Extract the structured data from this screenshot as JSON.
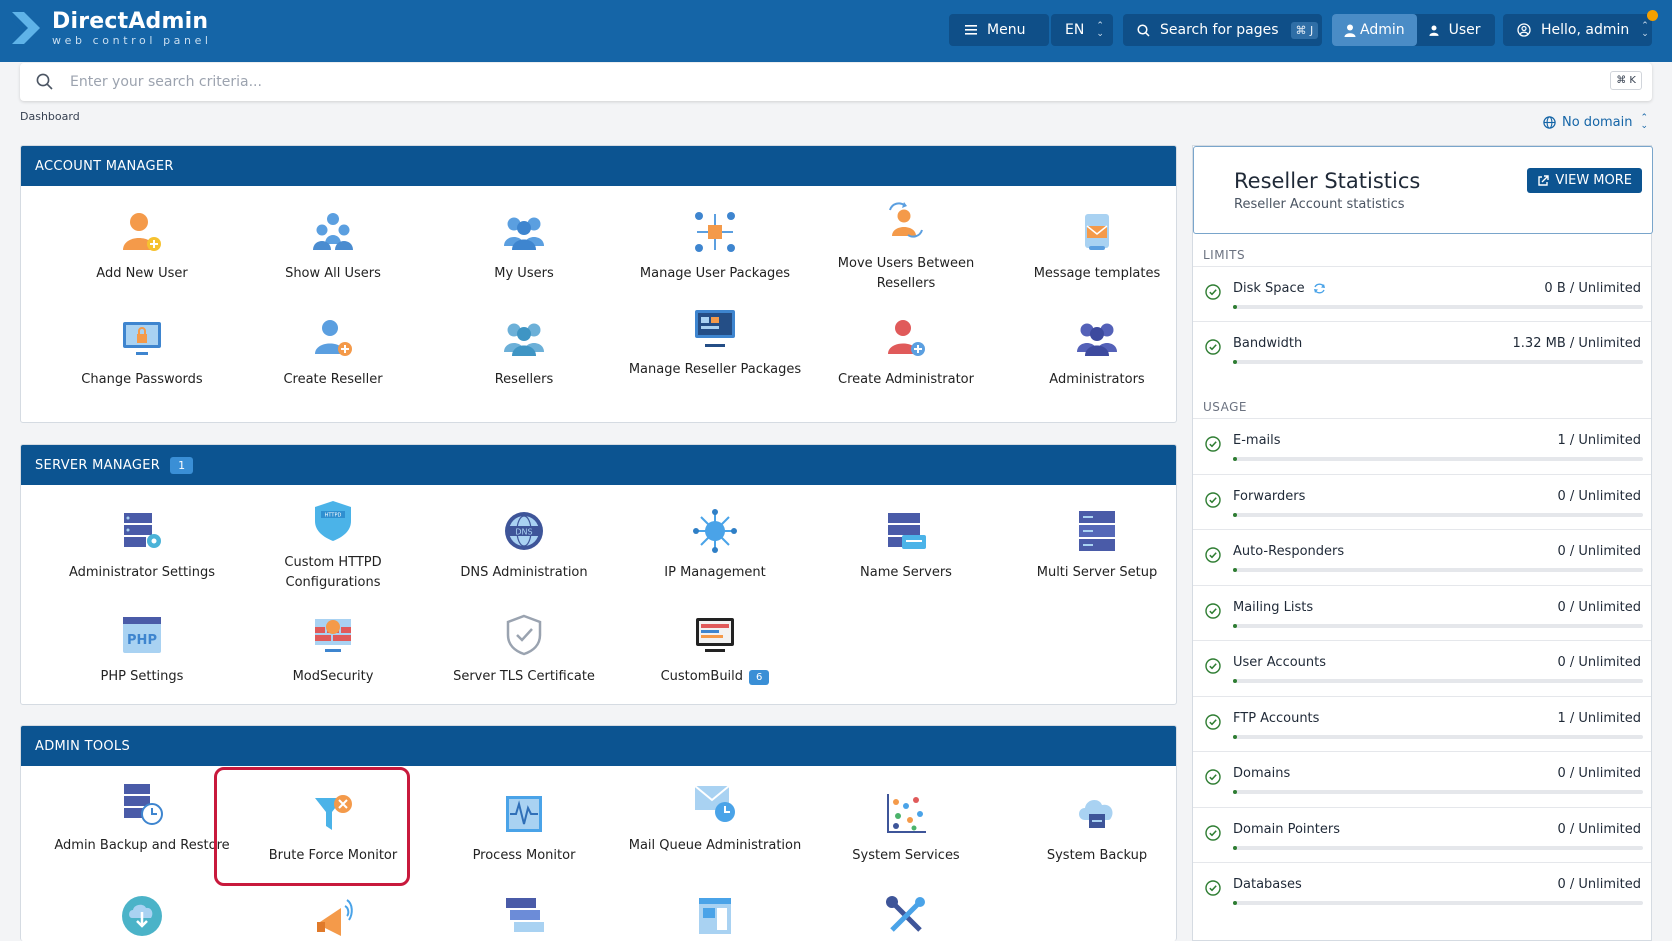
{
  "brand": {
    "title": "DirectAdmin",
    "subtitle": "web control panel"
  },
  "header": {
    "menu_label": "Menu",
    "language": "EN",
    "search_pages_label": "Search for pages",
    "search_pages_shortcut": "⌘ J",
    "role_admin": "Admin",
    "role_user": "User",
    "greeting": "Hello, admin"
  },
  "search": {
    "placeholder": "Enter your search criteria...",
    "shortcut": "⌘ K"
  },
  "breadcrumb": "Dashboard",
  "domain_selector": "No domain",
  "account_manager": {
    "title": "ACCOUNT MANAGER",
    "items": [
      "Add New User",
      "Show All Users",
      "My Users",
      "Manage User Packages",
      "Move Users Between Resellers",
      "Message templates",
      "Change Passwords",
      "Create Reseller",
      "Resellers",
      "Manage Reseller Packages",
      "Create Administrator",
      "Administrators"
    ]
  },
  "server_manager": {
    "title": "SERVER MANAGER",
    "badge": "1",
    "items": [
      "Administrator Settings",
      "Custom HTTPD Configurations",
      "DNS Administration",
      "IP Management",
      "Name Servers",
      "Multi Server Setup",
      "PHP Settings",
      "ModSecurity",
      "Server TLS Certificate",
      "CustomBuild"
    ],
    "custombuild_badge": "6"
  },
  "admin_tools": {
    "title": "ADMIN TOOLS",
    "items": [
      "Admin Backup and Restore",
      "Brute Force Monitor",
      "Process Monitor",
      "Mail Queue Administration",
      "System Services",
      "System Backup"
    ]
  },
  "reseller_stats": {
    "title": "Reseller Statistics",
    "subtitle": "Reseller Account statistics",
    "view_more": "VIEW MORE",
    "limits_label": "LIMITS",
    "usage_label": "USAGE",
    "limits": [
      {
        "name": "Disk Space",
        "value": "0 B / Unlimited"
      },
      {
        "name": "Bandwidth",
        "value": "1.32 MB / Unlimited"
      }
    ],
    "usage": [
      {
        "name": "E-mails",
        "value": "1 / Unlimited"
      },
      {
        "name": "Forwarders",
        "value": "0 / Unlimited"
      },
      {
        "name": "Auto-Responders",
        "value": "0 / Unlimited"
      },
      {
        "name": "Mailing Lists",
        "value": "0 / Unlimited"
      },
      {
        "name": "User Accounts",
        "value": "0 / Unlimited"
      },
      {
        "name": "FTP Accounts",
        "value": "1 / Unlimited"
      },
      {
        "name": "Domains",
        "value": "0 / Unlimited"
      },
      {
        "name": "Domain Pointers",
        "value": "0 / Unlimited"
      },
      {
        "name": "Databases",
        "value": "0 / Unlimited"
      }
    ]
  },
  "colors": {
    "header": "#1565a7",
    "panel_head": "#0c5491",
    "highlight": "#c8193c",
    "badge": "#3a8fd6"
  }
}
